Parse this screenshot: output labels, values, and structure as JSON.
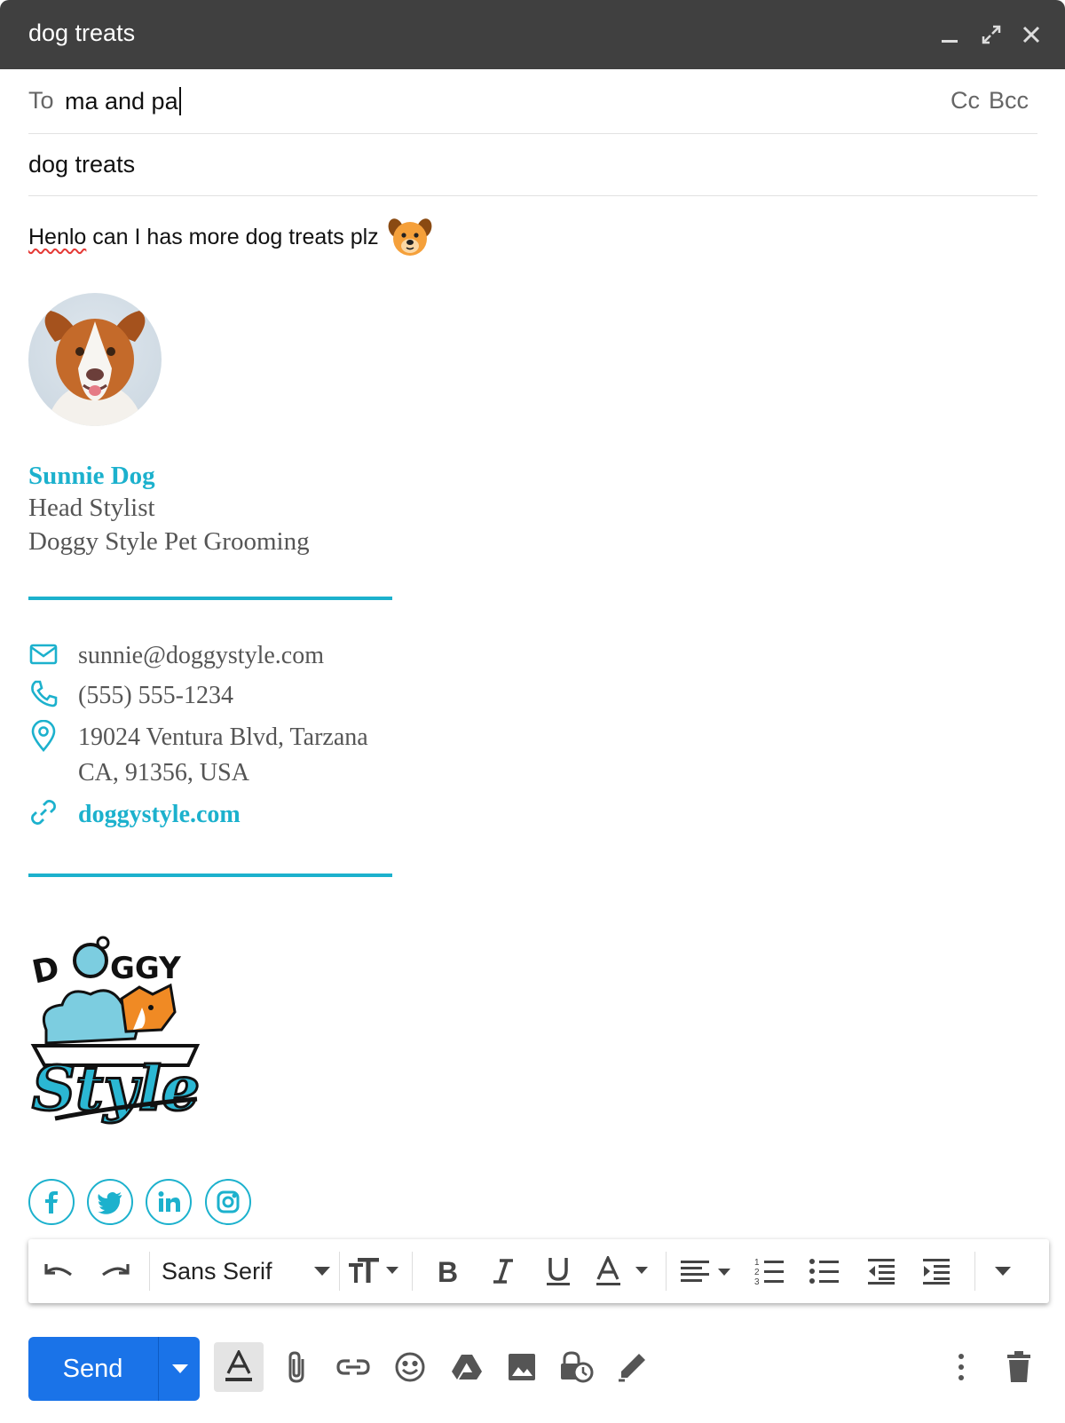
{
  "window": {
    "title": "dog treats"
  },
  "to": {
    "label": "To",
    "value": "ma and pa",
    "cc": "Cc",
    "bcc": "Bcc"
  },
  "subject": {
    "value": "dog treats"
  },
  "body": {
    "text": "can I has more dog treats plz",
    "misspelled_word": "Henlo",
    "emoji": "dog-face"
  },
  "signature": {
    "name": "Sunnie Dog",
    "title": "Head Stylist",
    "company": "Doggy Style Pet Grooming",
    "email": "sunnie@doggystyle.com",
    "phone": "(555) 555-1234",
    "address_line1": "19024 Ventura Blvd, Tarzana",
    "address_line2": "CA, 91356, USA",
    "website": "doggystyle.com",
    "logo_text": "DOGGY Style",
    "social": [
      "facebook-icon",
      "twitter-icon",
      "linkedin-icon",
      "instagram-icon"
    ],
    "accent_color": "#1cb1cd"
  },
  "toolbar": {
    "font": "Sans Serif"
  },
  "send": {
    "label": "Send",
    "color": "#1a73e8"
  }
}
